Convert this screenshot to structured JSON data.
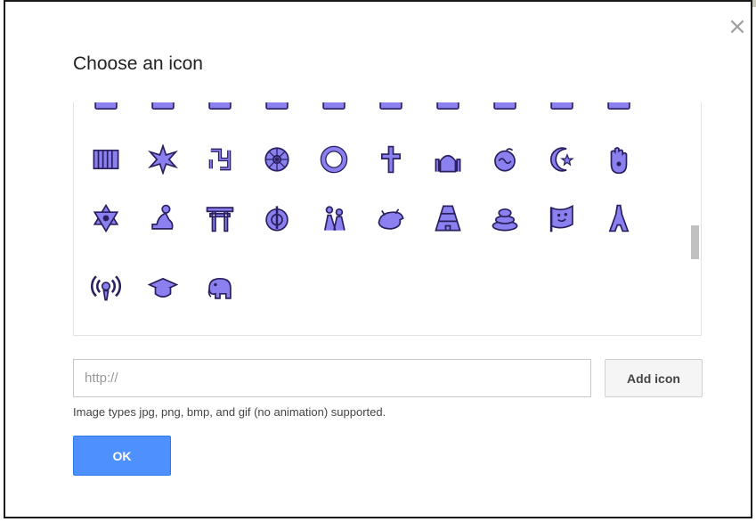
{
  "dialog": {
    "title": "Choose an icon",
    "close_label": "×",
    "url_placeholder": "http://",
    "url_value": "",
    "add_icon_label": "Add icon",
    "hint": "Image types jpg, png, bmp, and gif (no animation) supported.",
    "ok_label": "OK"
  },
  "icon_color": "#8a80f0",
  "icon_outline": "#2a2060",
  "icon_rows": [
    [
      "partial-icon",
      "partial-icon",
      "partial-icon",
      "partial-icon",
      "partial-icon",
      "partial-icon",
      "partial-icon",
      "partial-icon",
      "partial-icon",
      "partial-icon"
    ],
    [
      "fence-icon",
      "star-burst-icon",
      "swastika-icon",
      "dharma-wheel-icon",
      "ring-icon",
      "cross-icon",
      "mosque-icon",
      "om-icon",
      "crescent-star-icon",
      "hamsa-icon"
    ],
    [
      "star-of-david-icon",
      "praying-person-icon",
      "torii-gate-icon",
      "khanda-icon",
      "family-icon",
      "whale-icon",
      "pyramid-icon",
      "spiral-mound-icon",
      "flag-face-icon",
      "eiffel-tower-icon"
    ],
    [
      "broadcast-icon",
      "graduation-cap-icon",
      "elephant-icon"
    ]
  ]
}
